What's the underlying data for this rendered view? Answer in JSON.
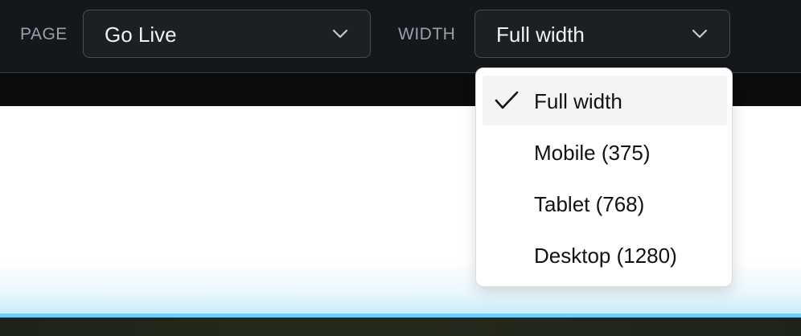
{
  "toolbar": {
    "page_label": "PAGE",
    "page_value": "Go Live",
    "width_label": "WIDTH",
    "width_value": "Full width"
  },
  "width_menu": {
    "items": [
      {
        "label": "Full width",
        "selected": true
      },
      {
        "label": "Mobile (375)",
        "selected": false
      },
      {
        "label": "Tablet (768)",
        "selected": false
      },
      {
        "label": "Desktop (1280)",
        "selected": false
      }
    ]
  },
  "icons": {
    "page_select_chevron": "chevron-down-icon",
    "width_select_chevron": "chevron-down-icon",
    "selected_check": "check-icon"
  },
  "colors": {
    "toolbar_bg": "#14171b",
    "canvas_accent": "#6fcef5"
  }
}
